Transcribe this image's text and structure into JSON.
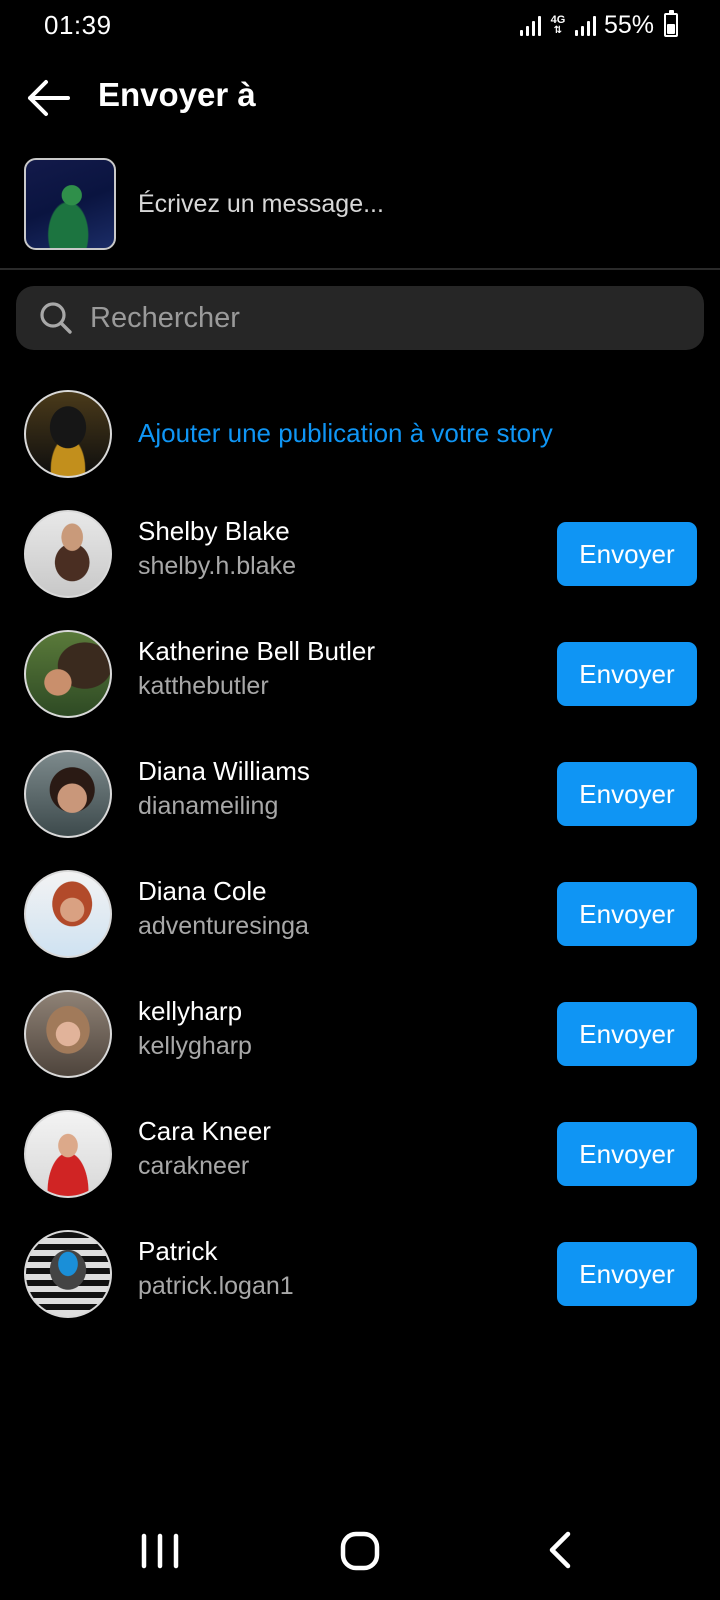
{
  "status_bar": {
    "time": "01:39",
    "network_type": "4G",
    "battery_percent": "55%",
    "battery_level": 0.55
  },
  "header": {
    "title": "Envoyer à",
    "back_icon": "arrow-left-icon"
  },
  "compose": {
    "placeholder": "Écrivez un message..."
  },
  "search": {
    "placeholder": "Rechercher",
    "icon": "search-icon"
  },
  "story": {
    "label": "Ajouter une publication à votre story"
  },
  "contacts": [
    {
      "name": "Shelby Blake",
      "username": "shelby.h.blake",
      "button": "Envoyer"
    },
    {
      "name": "Katherine Bell Butler",
      "username": "katthebutler",
      "button": "Envoyer"
    },
    {
      "name": "Diana Williams",
      "username": "dianameiling",
      "button": "Envoyer"
    },
    {
      "name": "Diana Cole",
      "username": "adventuresinga",
      "button": "Envoyer"
    },
    {
      "name": "kellyharp",
      "username": "kellygharp",
      "button": "Envoyer"
    },
    {
      "name": "Cara Kneer",
      "username": "carakneer",
      "button": "Envoyer"
    },
    {
      "name": "Patrick",
      "username": "patrick.logan1",
      "button": "Envoyer"
    }
  ],
  "nav_bar": {
    "icons": [
      "recent-apps-icon",
      "home-icon",
      "back-icon"
    ]
  },
  "colors": {
    "accent": "#0f95f4",
    "background": "#000000",
    "search_bg": "#262626",
    "secondary_text": "#a8a8a8"
  }
}
